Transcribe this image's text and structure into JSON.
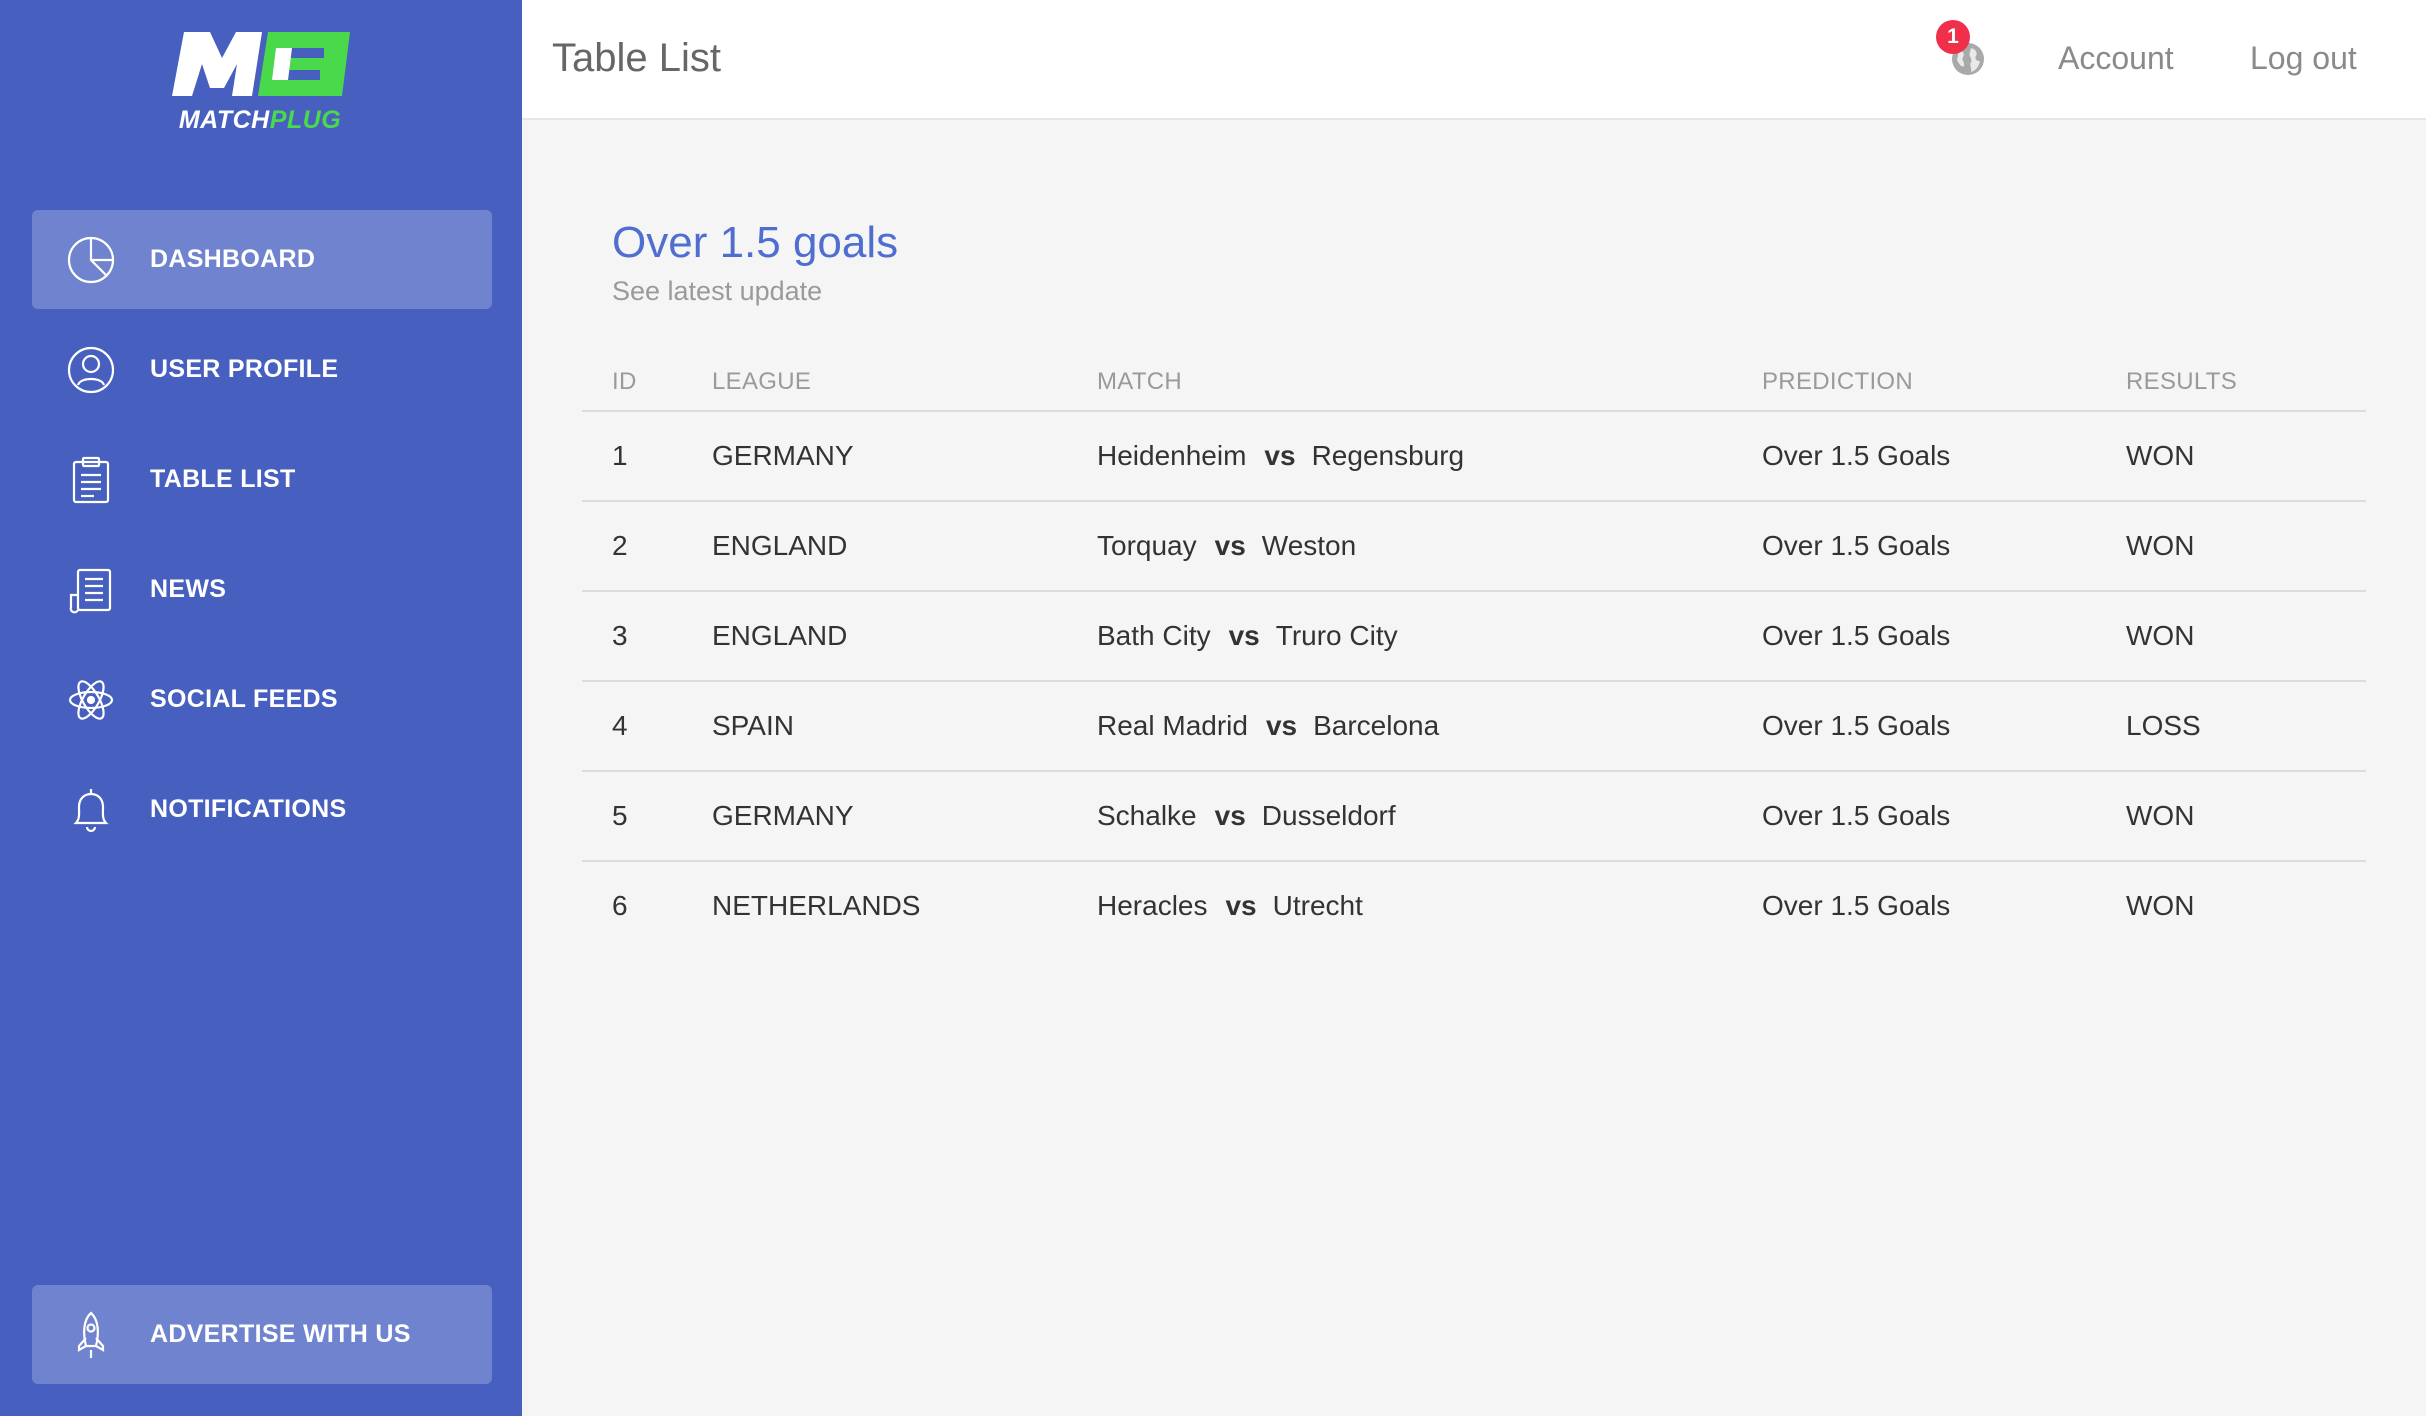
{
  "brand": {
    "word_white": "MATCH",
    "word_green": "PLUG",
    "green": "#4ad94a"
  },
  "sidebar": {
    "items": [
      {
        "label": "DASHBOARD",
        "icon": "pie-chart-icon",
        "active": true
      },
      {
        "label": "USER PROFILE",
        "icon": "user-icon",
        "active": false
      },
      {
        "label": "TABLE LIST",
        "icon": "clipboard-icon",
        "active": false
      },
      {
        "label": "NEWS",
        "icon": "newspaper-icon",
        "active": false
      },
      {
        "label": "SOCIAL FEEDS",
        "icon": "atom-icon",
        "active": false
      },
      {
        "label": "NOTIFICATIONS",
        "icon": "bell-icon",
        "active": false
      }
    ],
    "advertise": {
      "label": "ADVERTISE WITH US",
      "icon": "rocket-icon"
    }
  },
  "header": {
    "title": "Table List",
    "notification_count": "1",
    "account_label": "Account",
    "logout_label": "Log out"
  },
  "section": {
    "title": "Over 1.5 goals",
    "subtitle": "See latest update"
  },
  "table": {
    "columns": [
      "ID",
      "LEAGUE",
      "MATCH",
      "PREDICTION",
      "RESULTS"
    ],
    "vs_label": "vs",
    "rows": [
      {
        "id": "1",
        "league": "GERMANY",
        "home": "Heidenheim",
        "away": "Regensburg",
        "prediction": "Over 1.5 Goals",
        "result": "WON"
      },
      {
        "id": "2",
        "league": "ENGLAND",
        "home": "Torquay",
        "away": "Weston",
        "prediction": "Over 1.5 Goals",
        "result": "WON"
      },
      {
        "id": "3",
        "league": "ENGLAND",
        "home": "Bath City",
        "away": "Truro City",
        "prediction": "Over 1.5 Goals",
        "result": "WON"
      },
      {
        "id": "4",
        "league": "SPAIN",
        "home": "Real Madrid",
        "away": "Barcelona",
        "prediction": "Over 1.5 Goals",
        "result": "LOSS"
      },
      {
        "id": "5",
        "league": "GERMANY",
        "home": "Schalke",
        "away": "Dusseldorf",
        "prediction": "Over 1.5 Goals",
        "result": "WON"
      },
      {
        "id": "6",
        "league": "NETHERLANDS",
        "home": "Heracles",
        "away": "Utrecht",
        "prediction": "Over 1.5 Goals",
        "result": "WON"
      }
    ]
  }
}
